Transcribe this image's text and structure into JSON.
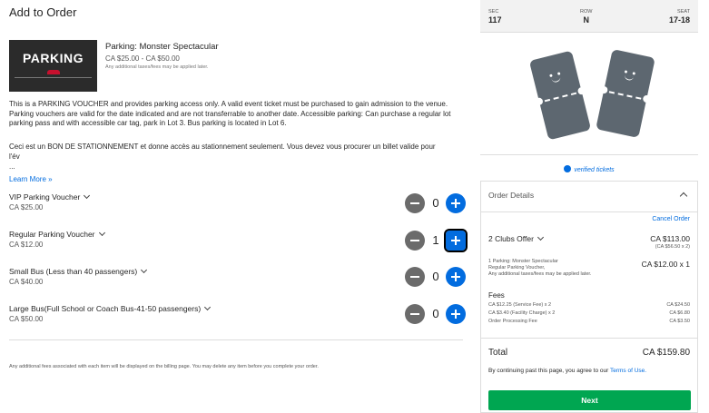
{
  "page_title": "Add to Order",
  "item": {
    "thumb_text": "PARKING",
    "name": "Parking: Monster Spectacular",
    "price_range": "CA $25.00 - CA $50.00",
    "tax_note": "Any additional taxes/fees may be applied later."
  },
  "description_en": "This is a PARKING VOUCHER and provides parking access only. A valid event ticket must be purchased to gain admission to the venue. Parking vouchers are valid for the date indicated and are not transferrable to another date. Accessible parking: Can purchase a regular lot parking pass and with accessible car tag, park in Lot 3. Bus parking is located in Lot 6.",
  "description_fr": "Ceci est un BON DE STATIONNEMENT et donne accès au stationnement seulement. Vous devez vous procurer un billet valide pour l'év",
  "ellipsis": "...",
  "learn_more": "Learn More »",
  "vouchers": [
    {
      "name": "VIP Parking Voucher",
      "price": "CA $25.00",
      "qty": "0"
    },
    {
      "name": "Regular Parking Voucher",
      "price": "CA $12.00",
      "qty": "1"
    },
    {
      "name": "Small Bus (Less than 40 passengers)",
      "price": "CA $40.00",
      "qty": "0"
    },
    {
      "name": "Large Bus(Full School or Coach Bus-41-50 passengers)",
      "price": "CA $50.00",
      "qty": "0"
    }
  ],
  "footnote": "Any additional fees associated with each item will be displayed on the billing page. You may delete any item before you complete your order.",
  "seat": {
    "sec_label": "SEC",
    "sec_value": "117",
    "row_label": "ROW",
    "row_value": "N",
    "seat_label": "SEAT",
    "seat_value": "17-18"
  },
  "verified": "verified tickets",
  "order": {
    "header": "Order Details",
    "cancel": "Cancel Order",
    "offer_name": "2 Clubs Offer",
    "offer_price": "CA $113.00",
    "offer_sub": "(CA $56.50 x 2)",
    "parking_desc_1": "1 Parking: Monster Spectacular",
    "parking_desc_2": "Regular Parking Voucher,",
    "parking_desc_3": "Any additional taxes/fees may be applied later.",
    "parking_price": "CA $12.00 x 1",
    "fees_title": "Fees",
    "fees": [
      {
        "label": "CA $12.25 (Service Fee) x 2",
        "amount": "CA $24.50"
      },
      {
        "label": "CA $3.40 (Facility Charge) x 2",
        "amount": "CA $6.80"
      },
      {
        "label": "Order Processing Fee",
        "amount": "CA $3.50"
      }
    ],
    "total_label": "Total",
    "total_value": "CA $159.80",
    "terms_prefix": "By continuing past this page, you agree to our",
    "terms_link": "Terms of Use.",
    "next": "Next"
  },
  "colors": {
    "accent": "#026cdf",
    "next": "#00a651",
    "ticket": "#5d6770"
  }
}
